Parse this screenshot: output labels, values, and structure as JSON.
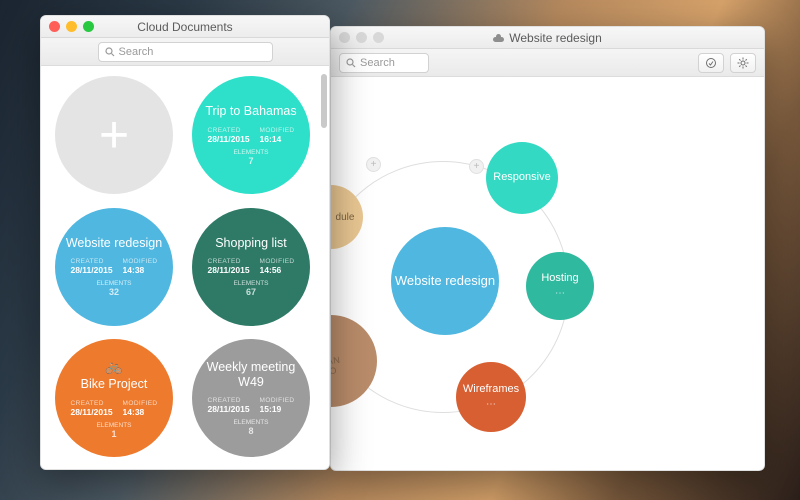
{
  "front_window": {
    "title": "Cloud Documents",
    "search_placeholder": "Search",
    "documents": [
      {
        "kind": "add"
      },
      {
        "title": "Trip to Bahamas",
        "created_lbl": "CREATED",
        "created": "28/11/2015",
        "modified_lbl": "MODIFIED",
        "modified": "16:14",
        "elements_lbl": "ELEMENTS",
        "elements": "7",
        "color": "#2ee0c9"
      },
      {
        "title": "Website redesign",
        "created_lbl": "CREATED",
        "created": "28/11/2015",
        "modified_lbl": "MODIFIED",
        "modified": "14:38",
        "elements_lbl": "ELEMENTS",
        "elements": "32",
        "color": "#4fb7e0"
      },
      {
        "title": "Shopping list",
        "created_lbl": "CREATED",
        "created": "28/11/2015",
        "modified_lbl": "MODIFIED",
        "modified": "14:56",
        "elements_lbl": "ELEMENTS",
        "elements": "67",
        "color": "#2e7a66"
      },
      {
        "title": "Bike Project",
        "created_lbl": "CREATED",
        "created": "28/11/2015",
        "modified_lbl": "MODIFIED",
        "modified": "14:38",
        "elements_lbl": "ELEMENTS",
        "elements": "1",
        "color": "#ee7a2d",
        "icon": "bike"
      },
      {
        "title": "Weekly meeting W49",
        "created_lbl": "CREATED",
        "created": "28/11/2015",
        "modified_lbl": "MODIFIED",
        "modified": "15:19",
        "elements_lbl": "ELEMENTS",
        "elements": "8",
        "color": "#9c9c9c"
      }
    ]
  },
  "back_window": {
    "title": "Website redesign",
    "search_placeholder": "Search",
    "center_node": "Website redesign",
    "nodes": {
      "responsive": "Responsive",
      "hosting": "Hosting",
      "wireframes": "Wireframes",
      "schedule": "dule"
    },
    "colors": {
      "center": "#4fb7e0",
      "responsive": "#33d9c2",
      "hosting": "#2fb99e",
      "wireframes": "#d85f32",
      "schedule": "#e9c792",
      "texture": "#b98c6a"
    }
  }
}
